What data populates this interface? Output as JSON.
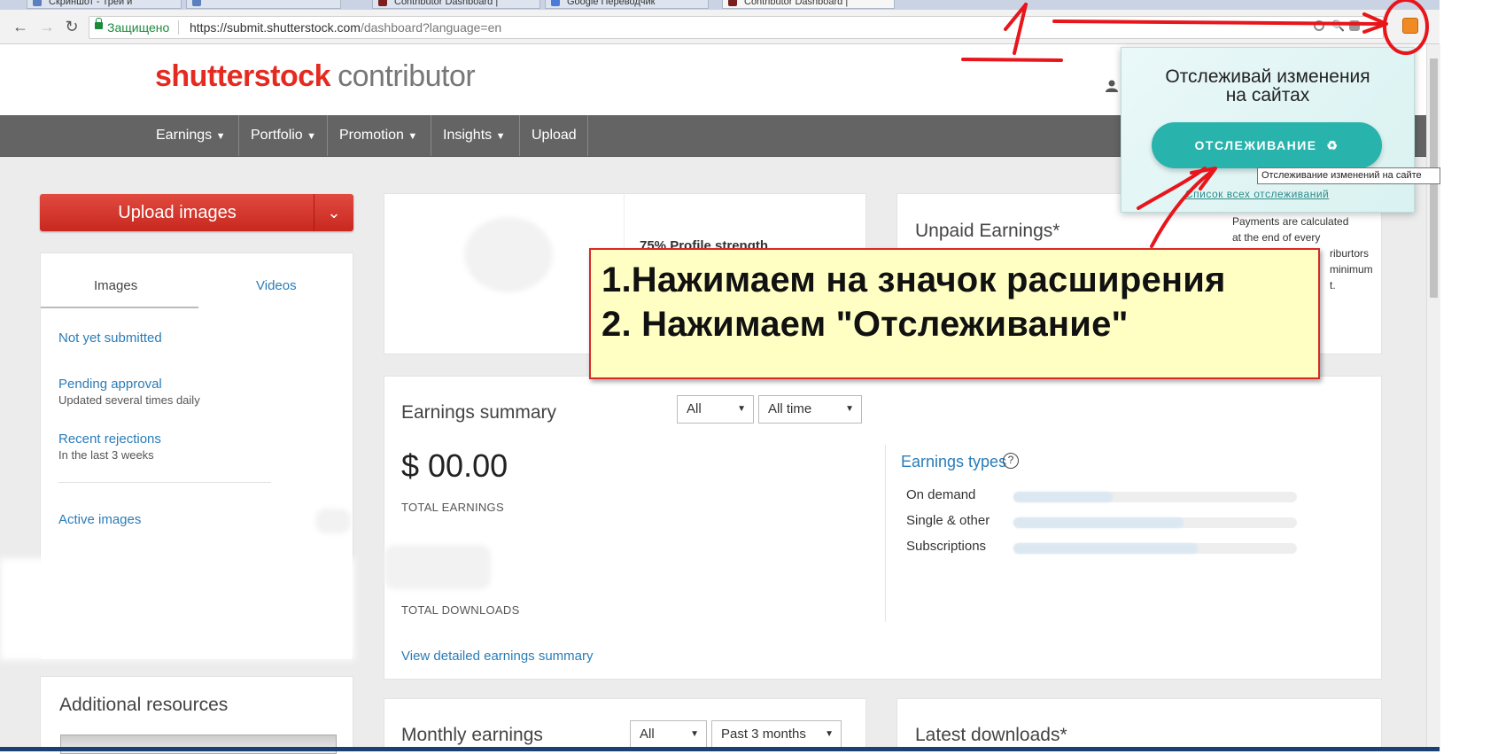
{
  "browser": {
    "tabs": [
      {
        "label": "Скриншот - Трей и"
      },
      {
        "label": ""
      },
      {
        "label": "Contributor Dashboard |"
      },
      {
        "label": "Google Переводчик"
      },
      {
        "label": "Contributor Dashboard |"
      }
    ],
    "secure_label": "Защищено",
    "url_host": "https://submit.shutterstock.com",
    "url_path": "/dashboard?language=en"
  },
  "header": {
    "brand": "shutterstock",
    "subbrand": "contributor"
  },
  "nav": {
    "items": [
      "Earnings",
      "Portfolio",
      "Promotion",
      "Insights",
      "Upload"
    ]
  },
  "sidebar": {
    "upload_label": "Upload images",
    "tab_images": "Images",
    "tab_videos": "Videos",
    "not_yet_submitted": "Not yet submitted",
    "pending_approval": "Pending approval",
    "pending_sub": "Updated several times daily",
    "recent_rejections": "Recent rejections",
    "rejections_sub": "In the last 3 weeks",
    "active_images": "Active images",
    "resources_title": "Additional resources"
  },
  "profile": {
    "strength_partial": "75% Profile strength"
  },
  "unpaid": {
    "title": "Unpaid Earnings*",
    "note_lines": [
      "Payments are calculated",
      "at the end of every",
      "riburtors",
      "minimum",
      "t."
    ]
  },
  "earnings_summary": {
    "title": "Earnings summary",
    "filter_type": "All",
    "filter_range": "All time",
    "total_value": "$ 00.00",
    "total_label": "TOTAL EARNINGS",
    "downloads_label": "TOTAL DOWNLOADS",
    "view_link": "View detailed earnings summary",
    "types_title": "Earnings types",
    "types": [
      {
        "label": "On demand",
        "fill": 0.35
      },
      {
        "label": "Single & other",
        "fill": 0.6
      },
      {
        "label": "Subscriptions",
        "fill": 0.65
      }
    ]
  },
  "monthly": {
    "title": "Monthly earnings",
    "filter_type": "All",
    "filter_range": "Past 3 months"
  },
  "latest_downloads": {
    "title": "Latest downloads*"
  },
  "popup": {
    "title_line1": "Отслеживай изменения",
    "title_line2": "на сайтах",
    "button_label": "ОТСЛЕЖИВАНИЕ",
    "button_icon": "♻",
    "all_link": "Список всех отслеживаний",
    "tooltip": "Отслеживание изменений на сайте"
  },
  "annotation": {
    "line1": "1.Нажимаем на значок расширения",
    "line2": "2. Нажимаем \"Отслеживание\""
  },
  "colors": {
    "brand_red": "#e52b20",
    "nav_gray": "#646464",
    "link_blue": "#2a7cb8",
    "teal": "#29b3ad",
    "annotation_red": "#e8151b",
    "callout_yellow": "#ffffc4"
  }
}
